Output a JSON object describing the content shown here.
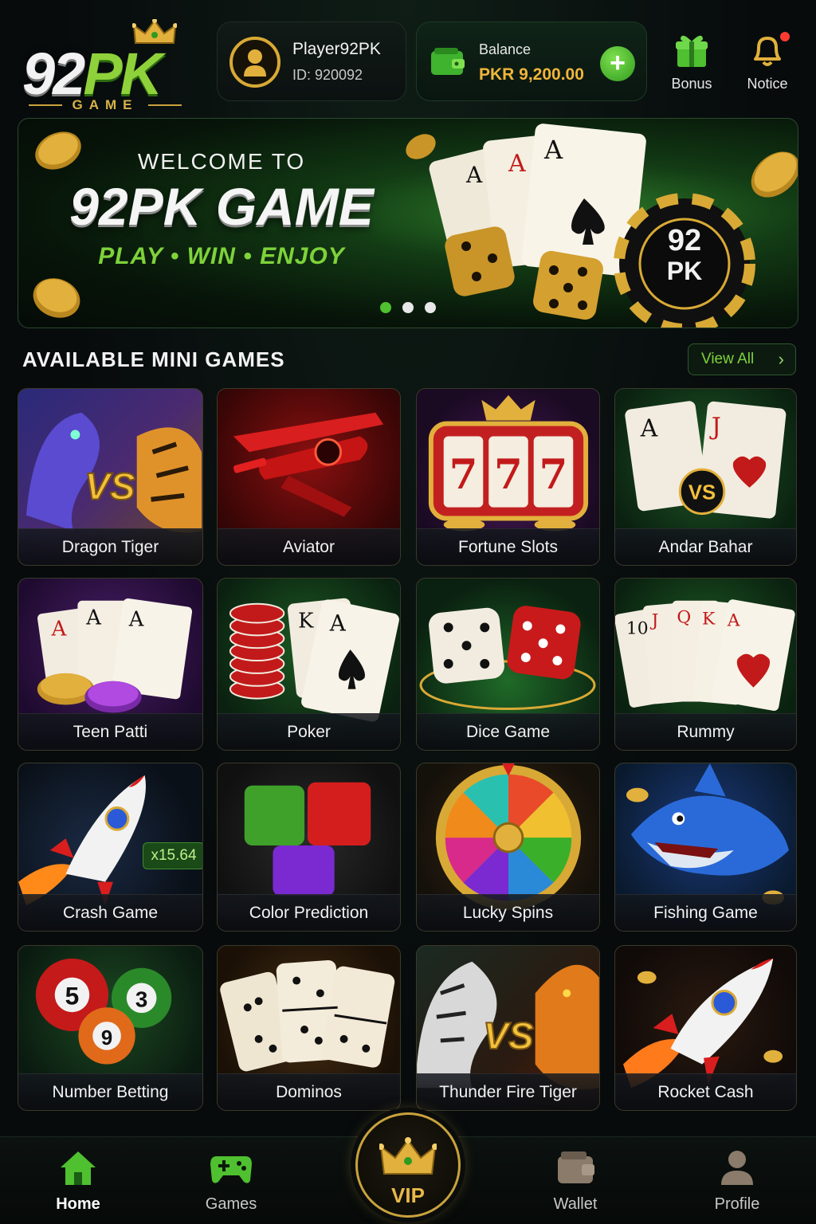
{
  "header": {
    "logo": {
      "text_main": "92",
      "text_accent": "PK",
      "text_sub": "GAME"
    },
    "player": {
      "name": "Player92PK",
      "id": "ID: 920092"
    },
    "balance": {
      "label": "Balance",
      "value": "PKR 9,200.00",
      "add_icon": "plus-icon"
    },
    "actions": [
      {
        "label": "Bonus",
        "icon": "gift-icon"
      },
      {
        "label": "Notice",
        "icon": "bell-icon"
      }
    ]
  },
  "banner": {
    "welcome": "WELCOME TO",
    "title": "92PK GAME",
    "tagline": "PLAY • WIN • ENJOY",
    "chip_text_top": "92",
    "chip_text_bottom": "PK",
    "carousel_dots": 3,
    "active_dot": 0
  },
  "section": {
    "title": "AVAILABLE MINI GAMES",
    "view_all": "View All"
  },
  "games": [
    {
      "name": "Dragon Tiger"
    },
    {
      "name": "Aviator"
    },
    {
      "name": "Fortune Slots"
    },
    {
      "name": "Andar Bahar"
    },
    {
      "name": "Teen Patti"
    },
    {
      "name": "Poker"
    },
    {
      "name": "Dice Game"
    },
    {
      "name": "Rummy"
    },
    {
      "name": "Crash Game",
      "badge": "x15.64"
    },
    {
      "name": "Color Prediction"
    },
    {
      "name": "Lucky Spins"
    },
    {
      "name": "Fishing Game"
    },
    {
      "name": "Number Betting",
      "balls": [
        "5",
        "3",
        "9"
      ]
    },
    {
      "name": "Dominos"
    },
    {
      "name": "Thunder Fire Tiger"
    },
    {
      "name": "Rocket Cash"
    }
  ],
  "game_art_text": {
    "vs": "VS",
    "slots": "7",
    "cards_dragon": [
      "A",
      "J"
    ],
    "teen_patti": [
      "A",
      "A",
      "A"
    ],
    "poker": [
      "K",
      "A"
    ],
    "rummy": [
      "10",
      "J",
      "Q",
      "K",
      "A"
    ]
  },
  "nav": {
    "items": [
      {
        "label": "Home",
        "icon": "home-icon",
        "active": true
      },
      {
        "label": "Games",
        "icon": "gamepad-icon",
        "active": false
      },
      {
        "label": "VIP",
        "icon": "crown-icon",
        "active": false
      },
      {
        "label": "Wallet",
        "icon": "wallet-icon",
        "active": false
      },
      {
        "label": "Profile",
        "icon": "user-icon",
        "active": false
      }
    ]
  },
  "colors": {
    "accent_green": "#7ed23a",
    "gold": "#d8a935",
    "balance_text": "#f0b63a",
    "notification_dot": "#ff3b30"
  }
}
